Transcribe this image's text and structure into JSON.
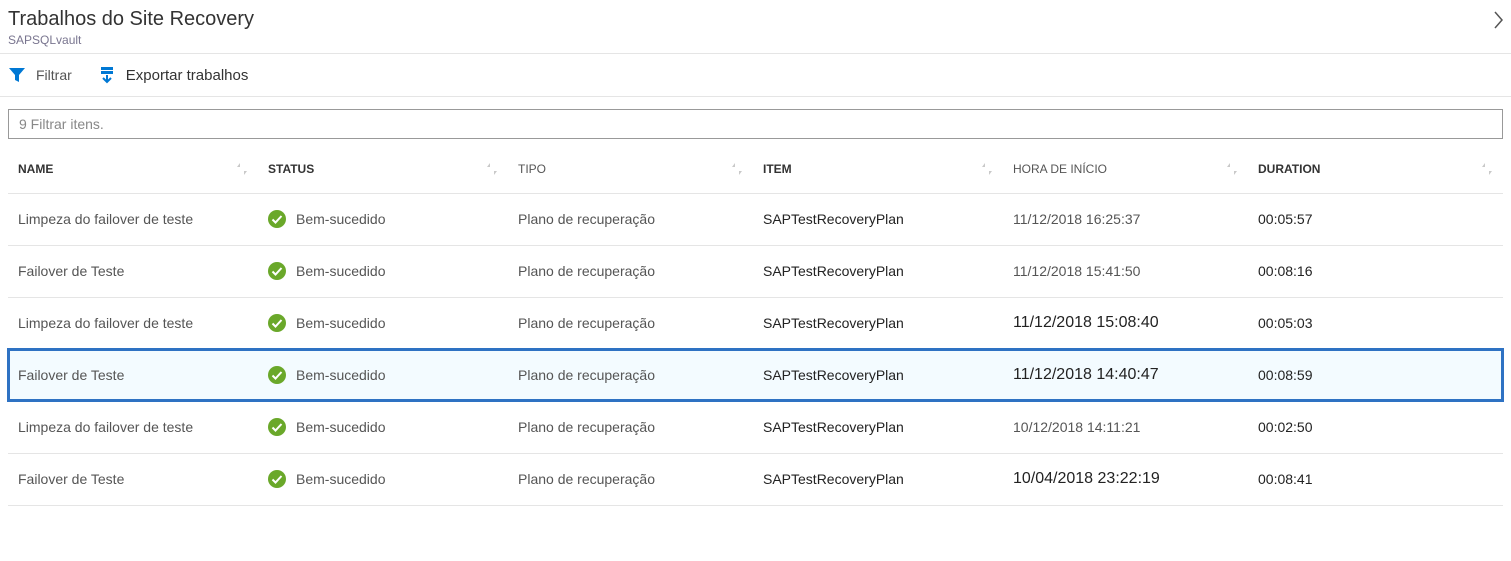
{
  "header": {
    "title": "Trabalhos do Site Recovery",
    "subtitle": "SAPSQLvault"
  },
  "toolbar": {
    "filter_label": "Filtrar",
    "export_label": "Exportar trabalhos"
  },
  "filter": {
    "placeholder": "9 Filtrar itens."
  },
  "columns": {
    "name": "NAME",
    "status": "STATUS",
    "tipo": "TIPO",
    "item": "ITEM",
    "hora": "HORA DE INÍCIO",
    "duration": "DURATION"
  },
  "status_text": "Bem-sucedido",
  "rows": [
    {
      "name": "Limpeza do failover de teste",
      "tipo": "Plano de recuperação",
      "item": "SAPTestRecoveryPlan",
      "hora": "11/12/2018 16:25:37",
      "duration": "00:05:57",
      "selected": false,
      "hora_big": false
    },
    {
      "name": "Failover de Teste",
      "tipo": "Plano de recuperação",
      "item": "SAPTestRecoveryPlan",
      "hora": "11/12/2018 15:41:50",
      "duration": "00:08:16",
      "selected": false,
      "hora_big": false
    },
    {
      "name": "Limpeza do failover de teste",
      "tipo": "Plano de recuperação",
      "item": "SAPTestRecoveryPlan",
      "hora": "11/12/2018 15:08:40",
      "duration": "00:05:03",
      "selected": false,
      "hora_big": true
    },
    {
      "name": "Failover de Teste",
      "tipo": "Plano de recuperação",
      "item": "SAPTestRecoveryPlan",
      "hora": "11/12/2018 14:40:47",
      "duration": "00:08:59",
      "selected": true,
      "hora_big": false
    },
    {
      "name": "Limpeza do failover de teste",
      "tipo": "Plano de recuperação",
      "item": "SAPTestRecoveryPlan",
      "hora": "10/12/2018 14:11:21",
      "duration": "00:02:50",
      "selected": false,
      "hora_big": false
    },
    {
      "name": "Failover de Teste",
      "tipo": "Plano de recuperação",
      "item": "SAPTestRecoveryPlan",
      "hora": "10/04/2018 23:22:19",
      "duration": "00:08:41",
      "selected": false,
      "hora_big": true
    }
  ],
  "colors": {
    "accent": "#0078d4",
    "success": "#6aa82a",
    "selected": "#2e72c3"
  }
}
